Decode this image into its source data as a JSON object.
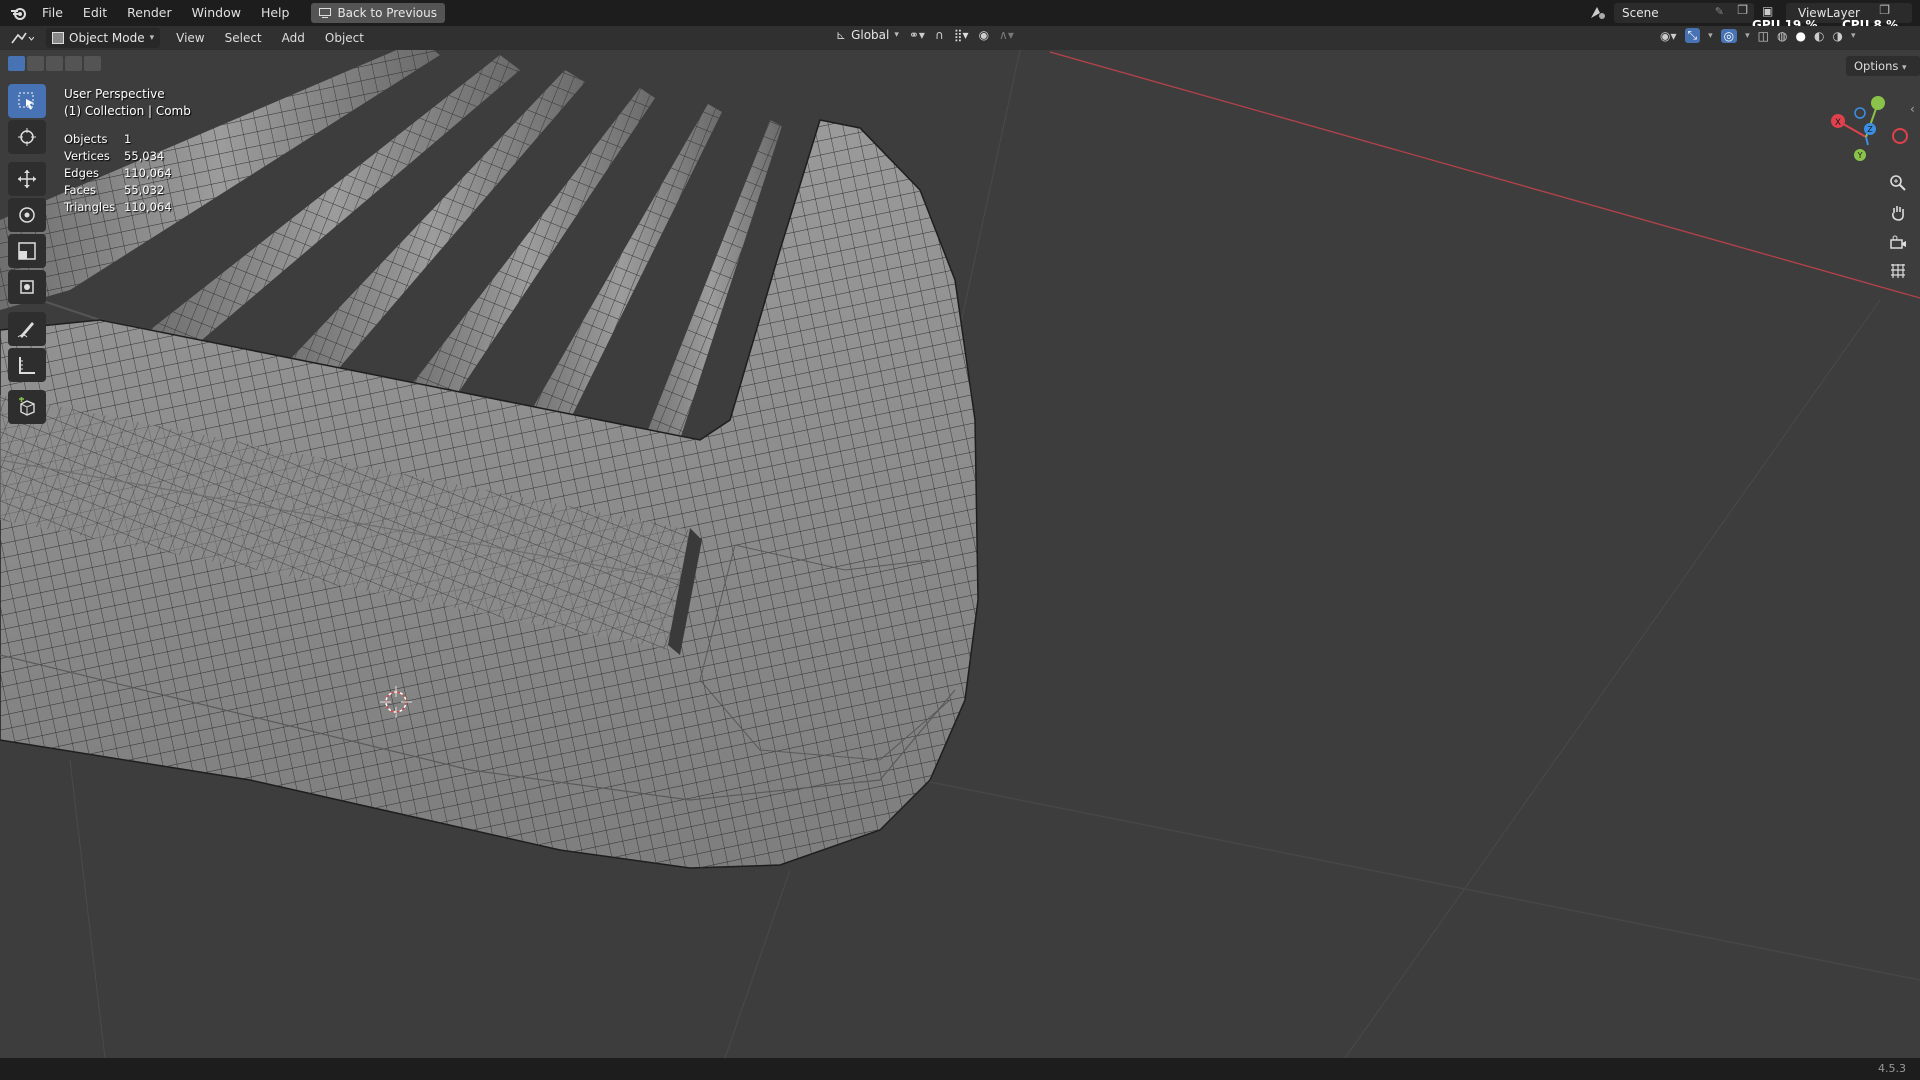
{
  "app": {
    "version": "4.5.3"
  },
  "menu": {
    "items": [
      "File",
      "Edit",
      "Render",
      "Window",
      "Help"
    ],
    "back_label": "Back to Previous"
  },
  "topright": {
    "scene": "Scene",
    "view_layer": "ViewLayer",
    "gpu_label": "GPU",
    "gpu_value": "19 %",
    "cpu_label": "CPU",
    "cpu_value": "8 %"
  },
  "header": {
    "mode": "Object Mode",
    "menus": [
      "View",
      "Select",
      "Add",
      "Object"
    ],
    "orientation": "Global",
    "options_label": "Options"
  },
  "viewport": {
    "perspective": "User Perspective",
    "collection": "(1) Collection | Comb",
    "stats": [
      {
        "label": "Objects",
        "value": "1"
      },
      {
        "label": "Vertices",
        "value": "55,034"
      },
      {
        "label": "Edges",
        "value": "110,064"
      },
      {
        "label": "Faces",
        "value": "55,032"
      },
      {
        "label": "Triangles",
        "value": "110,064"
      }
    ]
  },
  "gizmo": {
    "x_color": "#e0414d",
    "y_color": "#8bc34a",
    "z_color": "#3b8fe5"
  },
  "colors": {
    "accent": "#4772b3",
    "background": "#3d3d3d",
    "mesh": "#8a8a8a",
    "wire": "#2a2a2a"
  }
}
